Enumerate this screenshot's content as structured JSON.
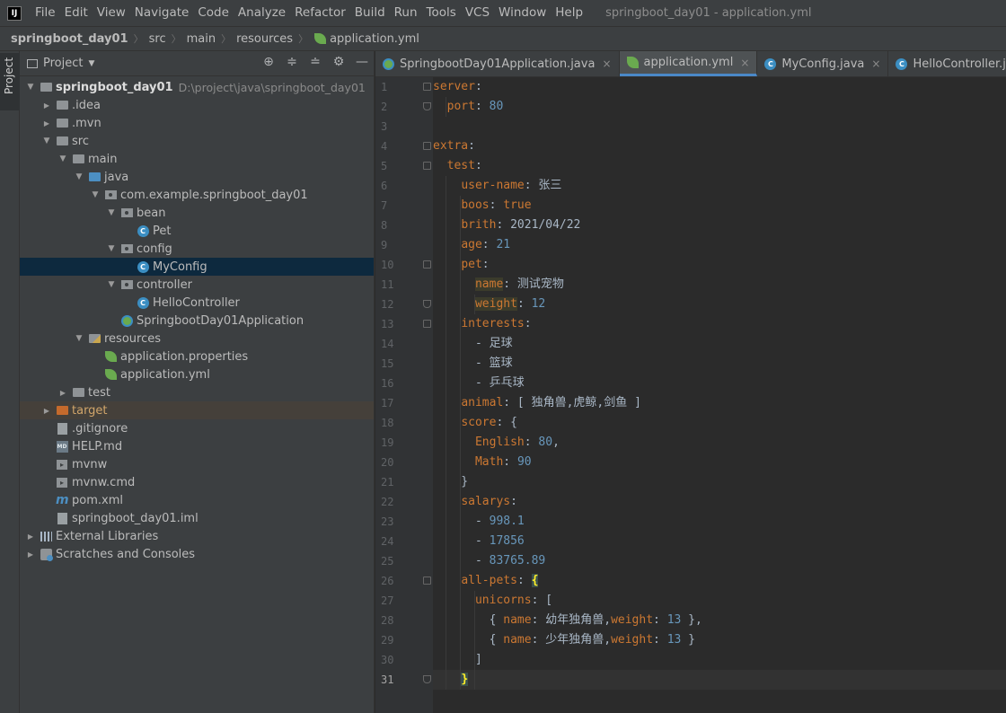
{
  "menubar": {
    "logo": "IJ",
    "items": [
      "File",
      "Edit",
      "View",
      "Navigate",
      "Code",
      "Analyze",
      "Refactor",
      "Build",
      "Run",
      "Tools",
      "VCS",
      "Window",
      "Help"
    ],
    "window_title": "springboot_day01 - application.yml"
  },
  "breadcrumb": {
    "items": [
      "springboot_day01",
      "src",
      "main",
      "resources",
      "application.yml"
    ]
  },
  "stripe": {
    "project_label": "Project"
  },
  "panel": {
    "title": "Project",
    "tools": [
      "locate-icon",
      "expand-all-icon",
      "collapse-all-icon",
      "gear-icon",
      "minimize-icon"
    ]
  },
  "tree": [
    {
      "label": "springboot_day01",
      "path": "D:\\project\\java\\springboot_day01",
      "icon": "module-folder",
      "depth": 0,
      "arrow": "down",
      "bold": true
    },
    {
      "label": ".idea",
      "icon": "folder",
      "depth": 1,
      "arrow": "right"
    },
    {
      "label": ".mvn",
      "icon": "folder",
      "depth": 1,
      "arrow": "right"
    },
    {
      "label": "src",
      "icon": "folder",
      "depth": 1,
      "arrow": "down"
    },
    {
      "label": "main",
      "icon": "folder",
      "depth": 2,
      "arrow": "down"
    },
    {
      "label": "java",
      "icon": "source-folder",
      "depth": 3,
      "arrow": "down"
    },
    {
      "label": "com.example.springboot_day01",
      "icon": "package",
      "depth": 4,
      "arrow": "down"
    },
    {
      "label": "bean",
      "icon": "package",
      "depth": 5,
      "arrow": "down"
    },
    {
      "label": "Pet",
      "icon": "class",
      "depth": 6,
      "arrow": "none"
    },
    {
      "label": "config",
      "icon": "package",
      "depth": 5,
      "arrow": "down"
    },
    {
      "label": "MyConfig",
      "icon": "class",
      "depth": 6,
      "arrow": "none",
      "selected": true
    },
    {
      "label": "controller",
      "icon": "package",
      "depth": 5,
      "arrow": "down"
    },
    {
      "label": "HelloController",
      "icon": "class",
      "depth": 6,
      "arrow": "none"
    },
    {
      "label": "SpringbootDay01Application",
      "icon": "spring-class",
      "depth": 5,
      "arrow": "none"
    },
    {
      "label": "resources",
      "icon": "resources-folder",
      "depth": 3,
      "arrow": "down"
    },
    {
      "label": "application.properties",
      "icon": "spring-leaf",
      "depth": 4,
      "arrow": "none"
    },
    {
      "label": "application.yml",
      "icon": "spring-leaf",
      "depth": 4,
      "arrow": "none"
    },
    {
      "label": "test",
      "icon": "folder",
      "depth": 2,
      "arrow": "right"
    },
    {
      "label": "target",
      "icon": "excluded-folder",
      "depth": 1,
      "arrow": "right",
      "excluded": true
    },
    {
      "label": ".gitignore",
      "icon": "file",
      "depth": 1,
      "arrow": "none"
    },
    {
      "label": "HELP.md",
      "icon": "markdown",
      "depth": 1,
      "arrow": "none"
    },
    {
      "label": "mvnw",
      "icon": "terminal",
      "depth": 1,
      "arrow": "none"
    },
    {
      "label": "mvnw.cmd",
      "icon": "terminal",
      "depth": 1,
      "arrow": "none"
    },
    {
      "label": "pom.xml",
      "icon": "maven",
      "depth": 1,
      "arrow": "none"
    },
    {
      "label": "springboot_day01.iml",
      "icon": "file",
      "depth": 1,
      "arrow": "none"
    },
    {
      "label": "External Libraries",
      "icon": "libraries",
      "depth": 0,
      "arrow": "right"
    },
    {
      "label": "Scratches and Consoles",
      "icon": "scratches",
      "depth": 0,
      "arrow": "right"
    }
  ],
  "tabs": [
    {
      "label": "SpringbootDay01Application.java",
      "icon": "spring",
      "active": false
    },
    {
      "label": "application.yml",
      "icon": "yml",
      "active": true
    },
    {
      "label": "MyConfig.java",
      "icon": "java",
      "active": false
    },
    {
      "label": "HelloController.java",
      "icon": "java",
      "active": false
    }
  ],
  "editor": {
    "current_line": 31,
    "lines": [
      {
        "n": 1,
        "t": [
          [
            "k",
            "server"
          ],
          [
            "p",
            ":"
          ]
        ]
      },
      {
        "n": 2,
        "t": [
          [
            "p",
            "  "
          ],
          [
            "k",
            "port"
          ],
          [
            "p",
            ": "
          ],
          [
            "n",
            "80"
          ]
        ]
      },
      {
        "n": 3,
        "t": []
      },
      {
        "n": 4,
        "t": [
          [
            "k",
            "extra"
          ],
          [
            "p",
            ":"
          ]
        ]
      },
      {
        "n": 5,
        "t": [
          [
            "p",
            "  "
          ],
          [
            "k",
            "test"
          ],
          [
            "p",
            ":"
          ]
        ]
      },
      {
        "n": 6,
        "t": [
          [
            "p",
            "    "
          ],
          [
            "k",
            "user-name"
          ],
          [
            "p",
            ": 张三"
          ]
        ]
      },
      {
        "n": 7,
        "t": [
          [
            "p",
            "    "
          ],
          [
            "k",
            "boos"
          ],
          [
            "p",
            ": "
          ],
          [
            "k",
            "true"
          ]
        ]
      },
      {
        "n": 8,
        "t": [
          [
            "p",
            "    "
          ],
          [
            "k",
            "brith"
          ],
          [
            "p",
            ": 2021/04/22"
          ]
        ]
      },
      {
        "n": 9,
        "t": [
          [
            "p",
            "    "
          ],
          [
            "k",
            "age"
          ],
          [
            "p",
            ": "
          ],
          [
            "n",
            "21"
          ]
        ]
      },
      {
        "n": 10,
        "t": [
          [
            "p",
            "    "
          ],
          [
            "k",
            "pet"
          ],
          [
            "p",
            ":"
          ]
        ]
      },
      {
        "n": 11,
        "t": [
          [
            "p",
            "      "
          ],
          [
            "kh",
            "name"
          ],
          [
            "p",
            ": 测试宠物"
          ]
        ]
      },
      {
        "n": 12,
        "t": [
          [
            "p",
            "      "
          ],
          [
            "kh",
            "weight"
          ],
          [
            "p",
            ": "
          ],
          [
            "n",
            "12"
          ]
        ]
      },
      {
        "n": 13,
        "t": [
          [
            "p",
            "    "
          ],
          [
            "k",
            "interests"
          ],
          [
            "p",
            ":"
          ]
        ]
      },
      {
        "n": 14,
        "t": [
          [
            "p",
            "      - 足球"
          ]
        ]
      },
      {
        "n": 15,
        "t": [
          [
            "p",
            "      - 篮球"
          ]
        ]
      },
      {
        "n": 16,
        "t": [
          [
            "p",
            "      - 乒乓球"
          ]
        ]
      },
      {
        "n": 17,
        "t": [
          [
            "p",
            "    "
          ],
          [
            "k",
            "animal"
          ],
          [
            "p",
            ": [ 独角兽,虎鲸,剑鱼 ]"
          ]
        ]
      },
      {
        "n": 18,
        "t": [
          [
            "p",
            "    "
          ],
          [
            "k",
            "score"
          ],
          [
            "p",
            ": {"
          ]
        ]
      },
      {
        "n": 19,
        "t": [
          [
            "p",
            "      "
          ],
          [
            "k",
            "English"
          ],
          [
            "p",
            ": "
          ],
          [
            "n",
            "80"
          ],
          [
            "p",
            ","
          ]
        ]
      },
      {
        "n": 20,
        "t": [
          [
            "p",
            "      "
          ],
          [
            "k",
            "Math"
          ],
          [
            "p",
            ": "
          ],
          [
            "n",
            "90"
          ]
        ]
      },
      {
        "n": 21,
        "t": [
          [
            "p",
            "    }"
          ]
        ]
      },
      {
        "n": 22,
        "t": [
          [
            "p",
            "    "
          ],
          [
            "k",
            "salarys"
          ],
          [
            "p",
            ":"
          ]
        ]
      },
      {
        "n": 23,
        "t": [
          [
            "p",
            "      - "
          ],
          [
            "n",
            "998.1"
          ]
        ]
      },
      {
        "n": 24,
        "t": [
          [
            "p",
            "      - "
          ],
          [
            "n",
            "17856"
          ]
        ]
      },
      {
        "n": 25,
        "t": [
          [
            "p",
            "      - "
          ],
          [
            "n",
            "83765.89"
          ]
        ]
      },
      {
        "n": 26,
        "t": [
          [
            "p",
            "    "
          ],
          [
            "k",
            "all-pets"
          ],
          [
            "p",
            ": "
          ],
          [
            "brace-h",
            "{"
          ]
        ]
      },
      {
        "n": 27,
        "t": [
          [
            "p",
            "      "
          ],
          [
            "k",
            "unicorns"
          ],
          [
            "p",
            ": ["
          ]
        ]
      },
      {
        "n": 28,
        "t": [
          [
            "p",
            "        { "
          ],
          [
            "k",
            "name"
          ],
          [
            "p",
            ": 幼年独角兽,"
          ],
          [
            "k",
            "weight"
          ],
          [
            "p",
            ": "
          ],
          [
            "n",
            "13"
          ],
          [
            "p",
            " },"
          ]
        ]
      },
      {
        "n": 29,
        "t": [
          [
            "p",
            "        { "
          ],
          [
            "k",
            "name"
          ],
          [
            "p",
            ": 少年独角兽,"
          ],
          [
            "k",
            "weight"
          ],
          [
            "p",
            ": "
          ],
          [
            "n",
            "13"
          ],
          [
            "p",
            " }"
          ]
        ]
      },
      {
        "n": 30,
        "t": [
          [
            "p",
            "      ]"
          ]
        ]
      },
      {
        "n": 31,
        "t": [
          [
            "p",
            "    "
          ],
          [
            "brace-h",
            "}"
          ]
        ]
      }
    ]
  },
  "colors": {
    "keyword": "#cc7832",
    "number": "#6897bb",
    "text": "#a9b7c6",
    "selection": "#0d293e",
    "accent": "#4a88c7"
  }
}
